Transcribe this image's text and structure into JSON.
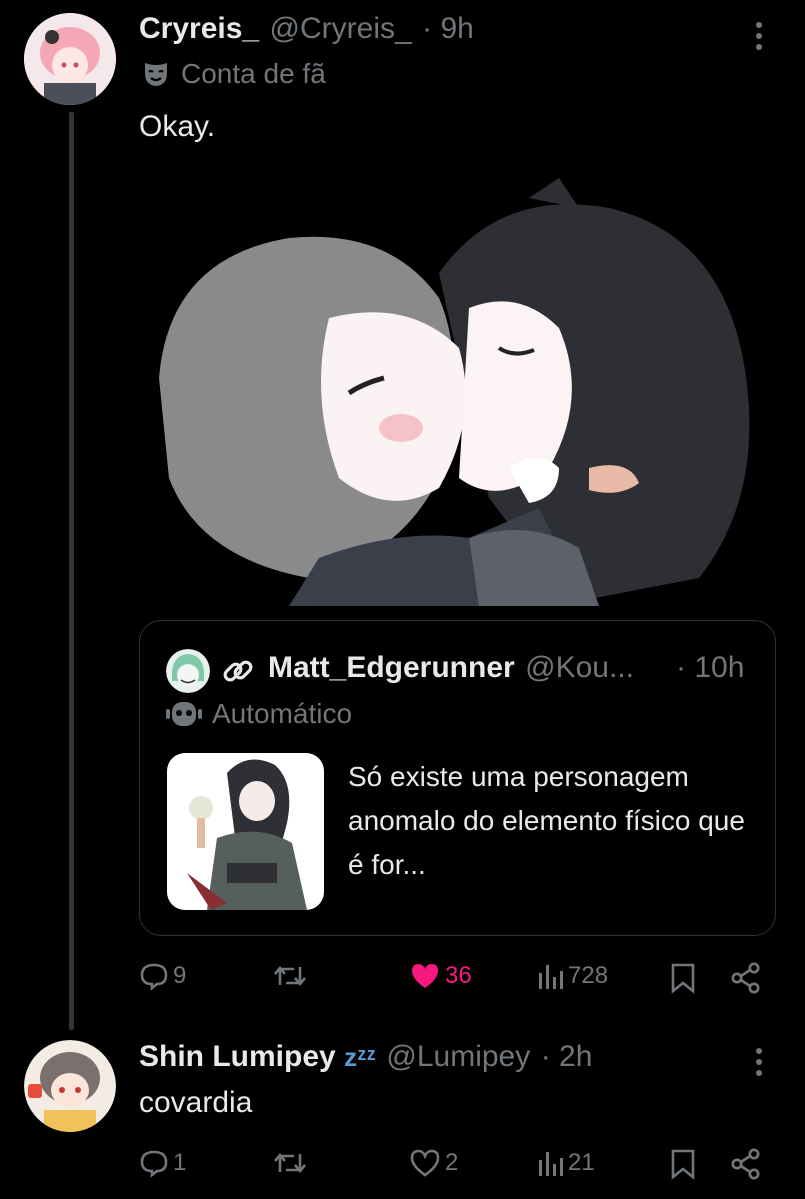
{
  "tweet1": {
    "name": "Cryreis_",
    "handle": "@Cryreis_",
    "time": "· 9h",
    "badge_label": "Conta de fã",
    "text": "Okay.",
    "actions": {
      "replies": "9",
      "likes": "36",
      "views": "728"
    }
  },
  "quote": {
    "name": "Matt_Edgerunner",
    "handle": "@Kou...",
    "time": "· 10h",
    "badge_label": "Automático",
    "text": "Só existe uma personagem anomalo do elemento físico que é for..."
  },
  "tweet2": {
    "name": "Shin Lumipey",
    "emoji": "zᶻᶻ",
    "handle": "@Lumipey",
    "time": "· 2h",
    "text": "covardia",
    "actions": {
      "replies": "1",
      "likes": "2",
      "views": "21"
    }
  },
  "colors": {
    "like_active": "#f91880",
    "muted": "#71767b",
    "border": "#2f3336"
  },
  "icons": [
    "reply-icon",
    "retweet-icon",
    "like-icon",
    "views-icon",
    "bookmark-icon",
    "share-icon",
    "mask-icon",
    "link-icon",
    "robot-icon",
    "more-icon"
  ]
}
